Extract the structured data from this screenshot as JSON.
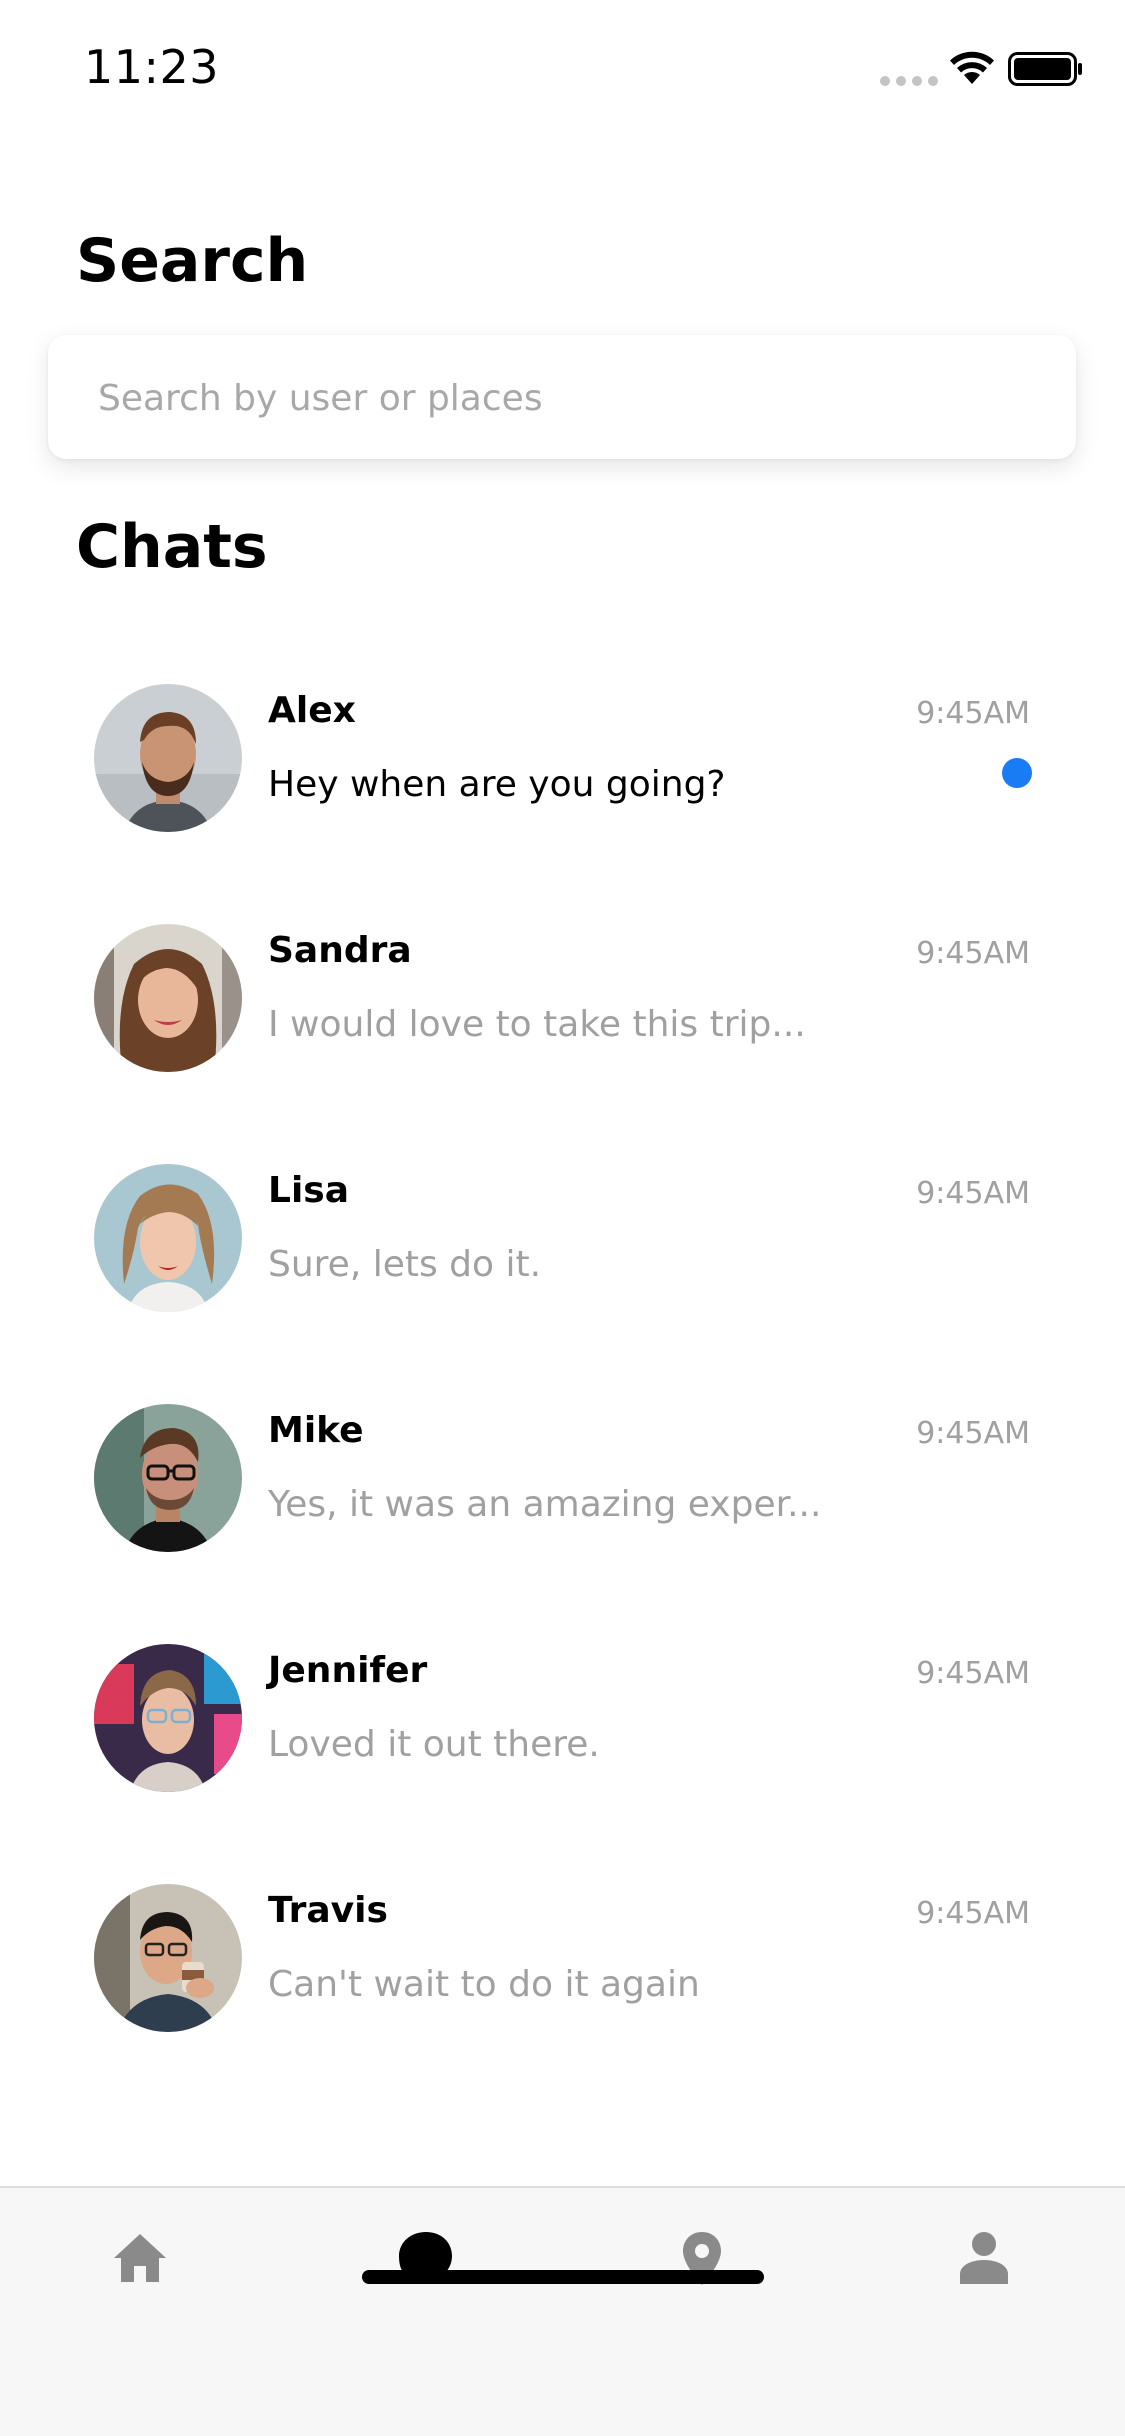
{
  "status_bar": {
    "time": "11:23",
    "wifi_icon": "wifi-icon",
    "battery_icon": "battery-icon"
  },
  "search": {
    "title": "Search",
    "placeholder": "Search by user or places"
  },
  "chats": {
    "title": "Chats",
    "items": [
      {
        "name": "Alex",
        "time": "9:45AM",
        "preview": "Hey when are you going?",
        "unread": true
      },
      {
        "name": "Sandra",
        "time": "9:45AM",
        "preview": "I would love to take this trip...",
        "unread": false
      },
      {
        "name": "Lisa",
        "time": "9:45AM",
        "preview": "Sure, lets do it.",
        "unread": false
      },
      {
        "name": "Mike",
        "time": "9:45AM",
        "preview": "Yes, it was an amazing exper...",
        "unread": false
      },
      {
        "name": "Jennifer",
        "time": "9:45AM",
        "preview": "Loved it out there.",
        "unread": false
      },
      {
        "name": "Travis",
        "time": "9:45AM",
        "preview": "Can't wait to do it again",
        "unread": false
      }
    ]
  },
  "tab_bar": {
    "tabs": [
      {
        "icon": "home-icon",
        "active": false
      },
      {
        "icon": "chat-bubble-icon",
        "active": true
      },
      {
        "icon": "location-pin-icon",
        "active": false
      },
      {
        "icon": "person-icon",
        "active": false
      }
    ]
  },
  "colors": {
    "unread_dot": "#1a7cf5",
    "inactive_tab": "#8a8a8a",
    "active_tab": "#000000",
    "muted_text": "#a0a0a0"
  }
}
